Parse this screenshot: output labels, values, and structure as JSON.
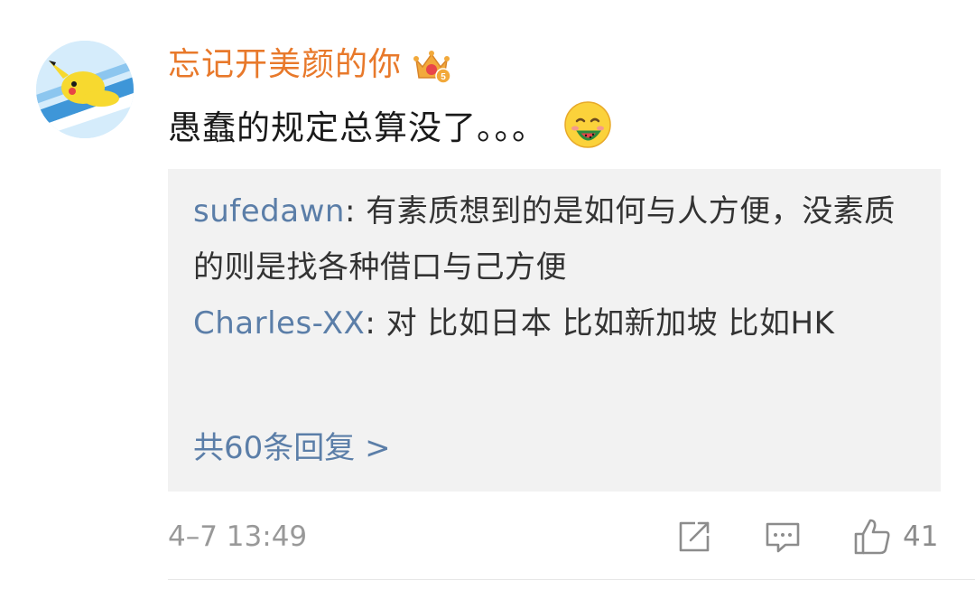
{
  "comment": {
    "username": "忘记开美颜的你",
    "badge_icon": "crown-badge-icon",
    "text": "愚蠢的规定总算没了。。。",
    "emoji_icon": "watermelon-emoji-icon",
    "name_color": "#e8792b"
  },
  "replies": [
    {
      "name": "sufedawn",
      "separator": ": ",
      "text": "有素质想到的是如何与人方便，没素质的则是找各种借口与己方便"
    },
    {
      "name": "Charles-XX",
      "separator": ": ",
      "text": "对 比如日本 比如新加坡 比如HK"
    }
  ],
  "more_replies_label": "共60条回复 >",
  "footer": {
    "timestamp": "4–7 13:49",
    "share_icon": "share-icon",
    "reply_icon": "comment-icon",
    "like_icon": "thumbs-up-icon",
    "like_count": "41"
  },
  "colors": {
    "link_blue": "#5b7ea8",
    "reply_bg": "#f2f2f2",
    "muted": "#999999"
  }
}
